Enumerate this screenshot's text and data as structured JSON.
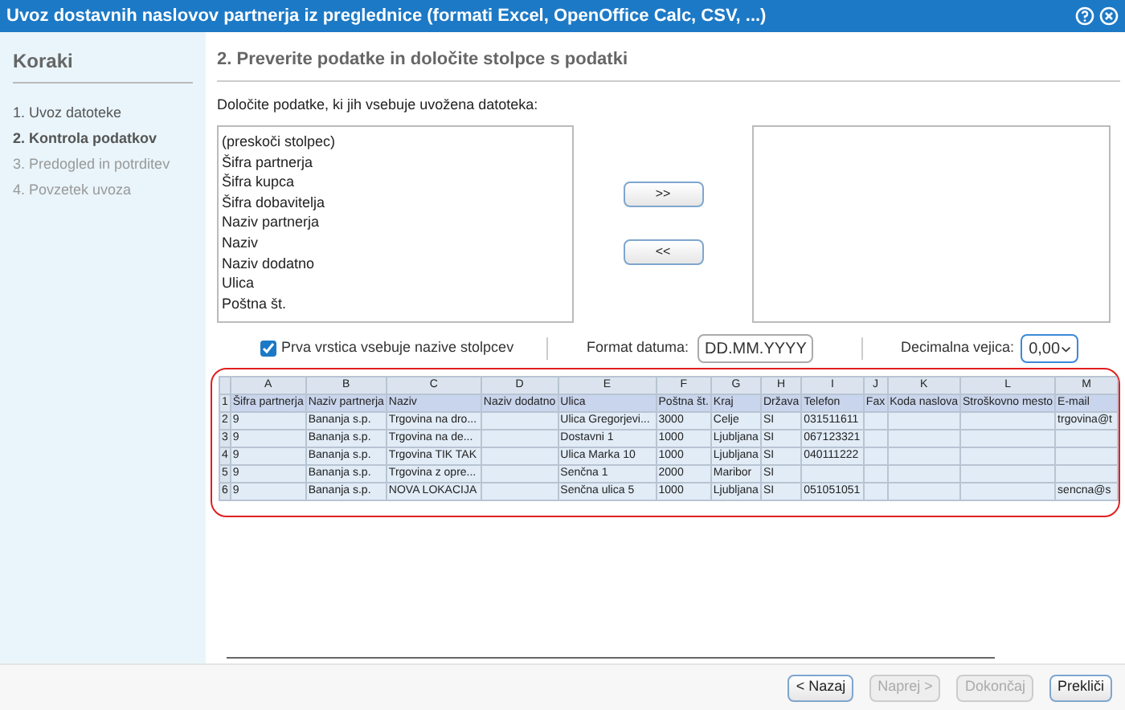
{
  "window": {
    "title": "Uvoz dostavnih naslovov partnerja iz preglednice (formati Excel, OpenOffice Calc, CSV, ...)"
  },
  "sidebar": {
    "title": "Koraki",
    "steps": [
      {
        "label": "1. Uvoz datoteke",
        "selected": false,
        "disabled": false
      },
      {
        "label": "2. Kontrola podatkov",
        "selected": true,
        "disabled": false
      },
      {
        "label": "3. Predogled in potrditev",
        "selected": false,
        "disabled": true
      },
      {
        "label": "4. Povzetek uvoza",
        "selected": false,
        "disabled": true
      }
    ]
  },
  "main": {
    "heading": "2. Preverite podatke in določite stolpce s podatki",
    "instruction": "Določite podatke, ki jih vsebuje uvožena datoteka:",
    "available_fields": [
      "(preskoči stolpec)",
      "Šifra partnerja",
      "Šifra kupca",
      "Šifra dobavitelja",
      "Naziv partnerja",
      "Naziv",
      "Naziv dodatno",
      "Ulica",
      "Poštna št."
    ],
    "move_buttons": [
      ">>",
      "<<"
    ],
    "options": {
      "header_row": {
        "label": "Prva vrstica vsebuje nazive stolpcev",
        "checked": true
      },
      "date_format": {
        "label": "Format datuma:",
        "value": "DD.MM.YYYY"
      },
      "decimal": {
        "label": "Decimalna vejica:",
        "value": "0,00",
        "focused": true
      }
    },
    "table": {
      "column_letters": [
        "A",
        "B",
        "C",
        "D",
        "E",
        "F",
        "G",
        "H",
        "I",
        "J",
        "K",
        "L",
        "M"
      ],
      "rows": [
        {
          "number": "1",
          "kind": "header",
          "cells": [
            "Šifra partnerja",
            "Naziv partnerja",
            "Naziv",
            "Naziv dodatno",
            "Ulica",
            "Poštna št.",
            "Kraj",
            "Država",
            "Telefon",
            "Fax",
            "Koda naslova",
            "Stroškovno mesto",
            "E-mail"
          ]
        },
        {
          "number": "2",
          "kind": "data",
          "cells": [
            "9",
            "Bananja s.p.",
            "Trgovina na dro...",
            "",
            "Ulica Gregorjevi...",
            "3000",
            "Celje",
            "SI",
            "031511611",
            "",
            "",
            "",
            "trgovina@t"
          ]
        },
        {
          "number": "3",
          "kind": "data",
          "cells": [
            "9",
            "Bananja s.p.",
            "Trgovina na de...",
            "",
            "Dostavni 1",
            "1000",
            "Ljubljana",
            "SI",
            "067123321",
            "",
            "",
            "",
            ""
          ]
        },
        {
          "number": "4",
          "kind": "data",
          "cells": [
            "9",
            "Bananja s.p.",
            "Trgovina TIK TAK",
            "",
            "Ulica Marka 10",
            "1000",
            "Ljubljana",
            "SI",
            "040111222",
            "",
            "",
            "",
            ""
          ]
        },
        {
          "number": "5",
          "kind": "data",
          "cells": [
            "9",
            "Bananja s.p.",
            "Trgovina z opre...",
            "",
            "Senčna 1",
            "2000",
            "Maribor",
            "SI",
            "",
            "",
            "",
            "",
            ""
          ]
        },
        {
          "number": "6",
          "kind": "data",
          "cells": [
            "9",
            "Bananja s.p.",
            "NOVA LOKACIJA",
            "",
            "Senčna ulica 5",
            "1000",
            "Ljubljana",
            "SI",
            "051051051",
            "",
            "",
            "",
            "sencna@s"
          ]
        }
      ]
    }
  },
  "footer": {
    "buttons": [
      {
        "label": "< Nazaj",
        "disabled": false
      },
      {
        "label": "Naprej >",
        "disabled": true
      },
      {
        "label": "Dokončaj",
        "disabled": true
      },
      {
        "label": "Prekliči",
        "disabled": false
      }
    ]
  }
}
